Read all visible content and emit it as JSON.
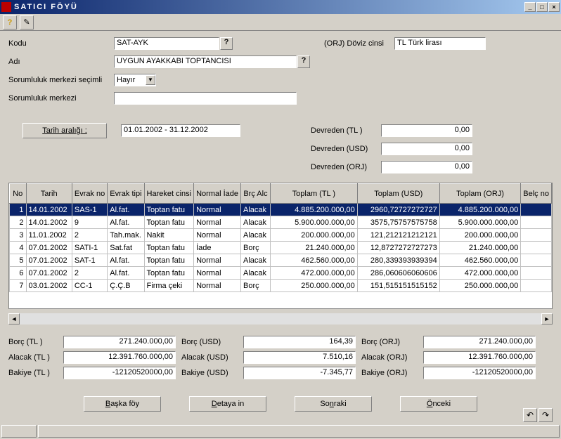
{
  "window": {
    "title": "SATICI FÖYÜ"
  },
  "form": {
    "kodu_label": "Kodu",
    "kodu_value": "SAT-AYK",
    "adi_label": "Adı",
    "adi_value": "UYGUN AYAKKABI TOPTANCISI",
    "sorumluluk_secimli_label": "Sorumluluk merkezi seçimli",
    "sorumluluk_secimli_value": "Hayır",
    "sorumluluk_label": "Sorumluluk merkezi",
    "sorumluluk_value": "",
    "doviz_cinsi_label": "(ORJ) Döviz cinsi",
    "doviz_cinsi_value": "TL  Türk lirası",
    "tarih_araligi_btn": "Tarih aralığı :",
    "tarih_araligi_value": "01.01.2002 - 31.12.2002",
    "devreden_tl_label": "Devreden (TL )",
    "devreden_tl_value": "0,00",
    "devreden_usd_label": "Devreden (USD)",
    "devreden_usd_value": "0,00",
    "devreden_orj_label": "Devreden (ORJ)",
    "devreden_orj_value": "0,00"
  },
  "grid": {
    "headers": [
      "No",
      "Tarih",
      "Evrak no",
      "Evrak tipi",
      "Hareket cinsi",
      "Normal İade",
      "Brç Alc",
      "Toplam (TL )",
      "Toplam (USD)",
      "Toplam (ORJ)",
      "Belç no"
    ],
    "rows": [
      {
        "no": "1",
        "tarih": "14.01.2002",
        "evrakno": "SAS-1",
        "evraktipi": "Al.fat.",
        "hareket": "Toptan fatu",
        "normal": "Normal",
        "brc": "Alacak",
        "tl": "4.885.200.000,00",
        "usd": "2960,72727272727",
        "orj": "4.885.200.000,00"
      },
      {
        "no": "2",
        "tarih": "14.01.2002",
        "evrakno": "9",
        "evraktipi": "Al.fat.",
        "hareket": "Toptan fatu",
        "normal": "Normal",
        "brc": "Alacak",
        "tl": "5.900.000.000,00",
        "usd": "3575,75757575758",
        "orj": "5.900.000.000,00"
      },
      {
        "no": "3",
        "tarih": "11.01.2002",
        "evrakno": "2",
        "evraktipi": "Tah.mak.",
        "hareket": "Nakit",
        "normal": "Normal",
        "brc": "Alacak",
        "tl": "200.000.000,00",
        "usd": "121,212121212121",
        "orj": "200.000.000,00"
      },
      {
        "no": "4",
        "tarih": "07.01.2002",
        "evrakno": "SATI-1",
        "evraktipi": "Sat.fat",
        "hareket": "Toptan fatu",
        "normal": "İade",
        "brc": "Borç",
        "tl": "21.240.000,00",
        "usd": "12,8727272727273",
        "orj": "21.240.000,00"
      },
      {
        "no": "5",
        "tarih": "07.01.2002",
        "evrakno": "SAT-1",
        "evraktipi": "Al.fat.",
        "hareket": "Toptan fatu",
        "normal": "Normal",
        "brc": "Alacak",
        "tl": "462.560.000,00",
        "usd": "280,339393939394",
        "orj": "462.560.000,00"
      },
      {
        "no": "6",
        "tarih": "07.01.2002",
        "evrakno": "2",
        "evraktipi": "Al.fat.",
        "hareket": "Toptan fatu",
        "normal": "Normal",
        "brc": "Alacak",
        "tl": "472.000.000,00",
        "usd": "286,060606060606",
        "orj": "472.000.000,00"
      },
      {
        "no": "7",
        "tarih": "03.01.2002",
        "evrakno": "CC-1",
        "evraktipi": "Ç.Ç.B",
        "hareket": "Firma çeki",
        "normal": "Normal",
        "brc": "Borç",
        "tl": "250.000.000,00",
        "usd": "151,515151515152",
        "orj": "250.000.000,00"
      }
    ]
  },
  "totals": {
    "borc_tl_label": "Borç  (TL )",
    "borc_tl": "271.240.000,00",
    "borc_usd_label": "Borç  (USD)",
    "borc_usd": "164,39",
    "borc_orj_label": "Borç  (ORJ)",
    "borc_orj": "271.240.000,00",
    "alacak_tl_label": "Alacak (TL )",
    "alacak_tl": "12.391.760.000,00",
    "alacak_usd_label": "Alacak (USD)",
    "alacak_usd": "7.510,16",
    "alacak_orj_label": "Alacak (ORJ)",
    "alacak_orj": "12.391.760.000,00",
    "bakiye_tl_label": "Bakiye (TL )",
    "bakiye_tl": "-12120520000,00",
    "bakiye_usd_label": "Bakiye (USD)",
    "bakiye_usd": "-7.345,77",
    "bakiye_orj_label": "Bakiye (ORJ)",
    "bakiye_orj": "-12120520000,00"
  },
  "buttons": {
    "baska_foy": "Başka föy",
    "detaya_in": "Detaya in",
    "sonraki": "Sonraki",
    "onceki": "Önceki"
  }
}
